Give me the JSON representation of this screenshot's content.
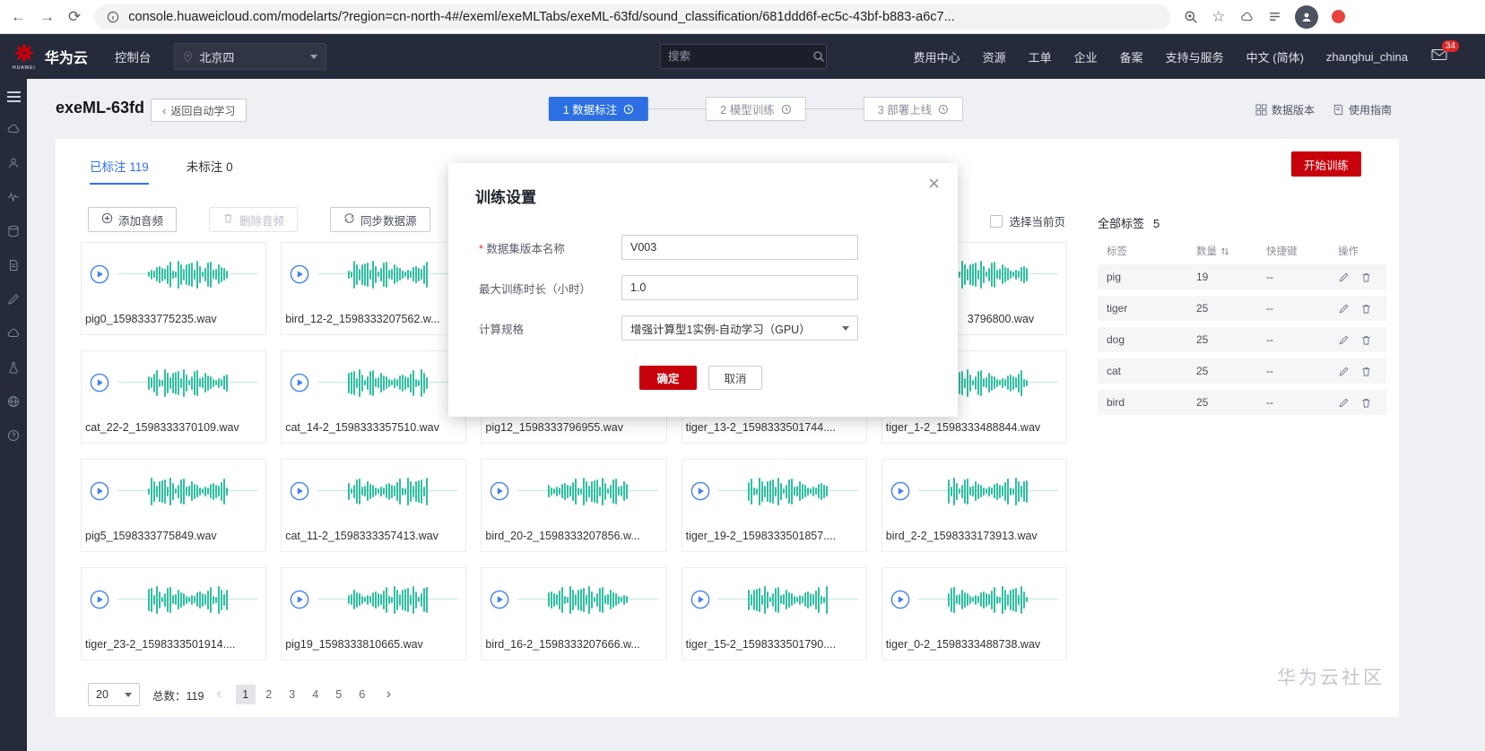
{
  "browser": {
    "url": "console.huaweicloud.com/modelarts/?region=cn-north-4#/exeml/exeMLTabs/exeML-63fd/sound_classification/681ddd6f-ec5c-43bf-b883-a6c7..."
  },
  "topnav": {
    "brand": "华为云",
    "logo_word": "HUAWEI",
    "console_label": "控制台",
    "region": "北京四",
    "search_placeholder": "搜索",
    "menu": [
      "费用中心",
      "资源",
      "工单",
      "企业",
      "备案",
      "支持与服务",
      "中文 (简体)",
      "zhanghui_china"
    ],
    "mail_badge": "34"
  },
  "sidebar": {
    "icons": [
      "cloud",
      "user",
      "waveform",
      "storage",
      "document",
      "edit",
      "cloud",
      "flask",
      "globe",
      "help"
    ]
  },
  "page": {
    "title": "exeML-63fd",
    "back_label": "返回自动学习",
    "steps": [
      {
        "label": "1 数据标注",
        "active": true
      },
      {
        "label": "2 模型训练",
        "active": false
      },
      {
        "label": "3 部署上线",
        "active": false
      }
    ],
    "header_links": [
      {
        "icon": "grid",
        "label": "数据版本"
      },
      {
        "icon": "book",
        "label": "使用指南"
      }
    ],
    "start_training_label": "开始训练"
  },
  "tabs": {
    "labeled": "已标注",
    "labeled_count": "119",
    "unlabeled": "未标注",
    "unlabeled_count": "0"
  },
  "toolbar": {
    "add_label": "添加音频",
    "delete_label": "删除音频",
    "sync_label": "同步数据源",
    "select_page_label": "选择当前页"
  },
  "labels_panel": {
    "title": "全部标签",
    "count": "5",
    "columns": [
      "标签",
      "数量",
      "快捷键",
      "操作"
    ],
    "rows": [
      {
        "label": "pig",
        "count": "19",
        "shortcut": "--"
      },
      {
        "label": "tiger",
        "count": "25",
        "shortcut": "--"
      },
      {
        "label": "dog",
        "count": "25",
        "shortcut": "--"
      },
      {
        "label": "cat",
        "count": "25",
        "shortcut": "--"
      },
      {
        "label": "bird",
        "count": "25",
        "shortcut": "--"
      }
    ]
  },
  "audio_grid": {
    "files": [
      [
        "pig0_1598333775235.wav",
        "bird_12-2_1598333207562.w...",
        "",
        "",
        "3796800.wav"
      ],
      [
        "cat_22-2_1598333370109.wav",
        "cat_14-2_1598333357510.wav",
        "pig12_1598333796955.wav",
        "tiger_13-2_1598333501744....",
        "tiger_1-2_1598333488844.wav"
      ],
      [
        "pig5_1598333775849.wav",
        "cat_11-2_1598333357413.wav",
        "bird_20-2_1598333207856.w...",
        "tiger_19-2_1598333501857....",
        "bird_2-2_1598333173913.wav"
      ],
      [
        "tiger_23-2_1598333501914....",
        "pig19_1598333810665.wav",
        "bird_16-2_1598333207666.w...",
        "tiger_15-2_1598333501790....",
        "tiger_0-2_1598333488738.wav"
      ]
    ]
  },
  "pagination": {
    "page_size": "20",
    "total_label": "总数：119",
    "pages": [
      "1",
      "2",
      "3",
      "4",
      "5",
      "6"
    ],
    "current": "1"
  },
  "modal": {
    "title": "训练设置",
    "fields": [
      {
        "label": "数据集版本名称",
        "required": true,
        "value": "V003",
        "type": "input"
      },
      {
        "label": "最大训练时长（小时）",
        "required": false,
        "value": "1.0",
        "type": "input"
      },
      {
        "label": "计算规格",
        "required": false,
        "value": "增强计算型1实例-自动学习（GPU）",
        "type": "select"
      }
    ],
    "ok_label": "确定",
    "cancel_label": "取消"
  },
  "watermark": "华为云社区",
  "colors": {
    "accent_blue": "#2b6fe3",
    "huawei_red": "#c7000b",
    "waveform_teal": "#2fbf9f",
    "navbar_dark": "#252b3a"
  }
}
